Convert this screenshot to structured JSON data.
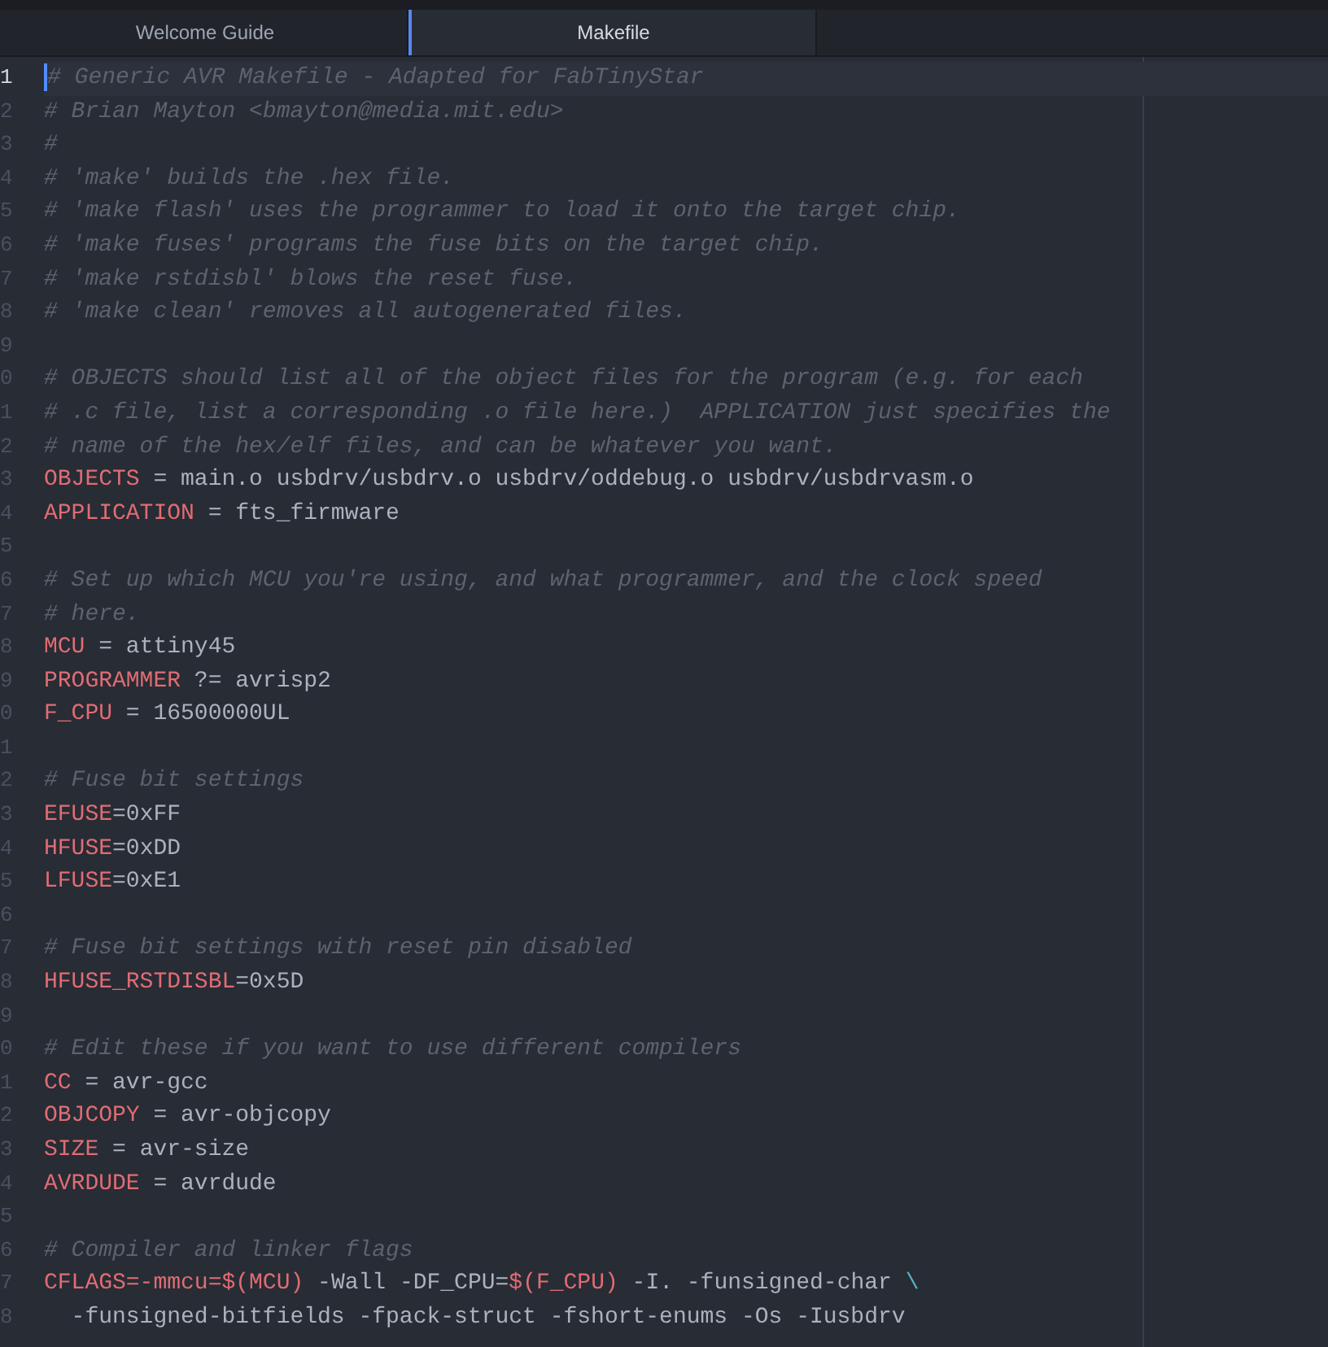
{
  "tabs": [
    {
      "label": "Welcome Guide",
      "selected": false
    },
    {
      "label": "Makefile",
      "selected": true
    }
  ],
  "editor": {
    "lines": [
      {
        "number": "1",
        "current": true,
        "segments": [
          {
            "kind": "comment",
            "text": "# Generic AVR Makefile - Adapted for FabTinyStar"
          }
        ]
      },
      {
        "number": "2",
        "current": false,
        "segments": [
          {
            "kind": "comment",
            "text": "# Brian Mayton <bmayton@media.mit.edu>"
          }
        ]
      },
      {
        "number": "3",
        "current": false,
        "segments": [
          {
            "kind": "comment",
            "text": "#"
          }
        ]
      },
      {
        "number": "4",
        "current": false,
        "segments": [
          {
            "kind": "comment",
            "text": "# 'make' builds the .hex file."
          }
        ]
      },
      {
        "number": "5",
        "current": false,
        "segments": [
          {
            "kind": "comment",
            "text": "# 'make flash' uses the programmer to load it onto the target chip."
          }
        ]
      },
      {
        "number": "6",
        "current": false,
        "segments": [
          {
            "kind": "comment",
            "text": "# 'make fuses' programs the fuse bits on the target chip."
          }
        ]
      },
      {
        "number": "7",
        "current": false,
        "segments": [
          {
            "kind": "comment",
            "text": "# 'make rstdisbl' blows the reset fuse."
          }
        ]
      },
      {
        "number": "8",
        "current": false,
        "segments": [
          {
            "kind": "comment",
            "text": "# 'make clean' removes all autogenerated files."
          }
        ]
      },
      {
        "number": "9",
        "current": false
      },
      {
        "number": "0",
        "current": false,
        "segments": [
          {
            "kind": "comment",
            "text": "# OBJECTS should list all of the object files for the program (e.g. for each"
          }
        ]
      },
      {
        "number": "1",
        "current": false,
        "segments": [
          {
            "kind": "comment",
            "text": "# .c file, list a corresponding .o file here.)  APPLICATION just specifies the"
          }
        ]
      },
      {
        "number": "2",
        "current": false,
        "segments": [
          {
            "kind": "comment",
            "text": "# name of the hex/elf files, and can be whatever you want."
          }
        ]
      },
      {
        "number": "3",
        "current": false,
        "segments": [
          {
            "kind": "variable",
            "text": "OBJECTS"
          },
          {
            "kind": "plain",
            "text": " = main.o usbdrv/usbdrv.o usbdrv/oddebug.o usbdrv/usbdrvasm.o"
          }
        ]
      },
      {
        "number": "4",
        "current": false,
        "segments": [
          {
            "kind": "variable",
            "text": "APPLICATION"
          },
          {
            "kind": "plain",
            "text": " = fts_firmware"
          }
        ]
      },
      {
        "number": "5",
        "current": false
      },
      {
        "number": "6",
        "current": false,
        "segments": [
          {
            "kind": "comment",
            "text": "# Set up which MCU you're using, and what programmer, and the clock speed"
          }
        ]
      },
      {
        "number": "7",
        "current": false,
        "segments": [
          {
            "kind": "comment",
            "text": "# here."
          }
        ]
      },
      {
        "number": "8",
        "current": false,
        "segments": [
          {
            "kind": "variable",
            "text": "MCU"
          },
          {
            "kind": "plain",
            "text": " = attiny45"
          }
        ]
      },
      {
        "number": "9",
        "current": false,
        "segments": [
          {
            "kind": "variable",
            "text": "PROGRAMMER"
          },
          {
            "kind": "plain",
            "text": " ?= avrisp2"
          }
        ]
      },
      {
        "number": "0",
        "current": false,
        "segments": [
          {
            "kind": "variable",
            "text": "F_CPU"
          },
          {
            "kind": "plain",
            "text": " = 16500000UL"
          }
        ]
      },
      {
        "number": "1",
        "current": false
      },
      {
        "number": "2",
        "current": false,
        "segments": [
          {
            "kind": "comment",
            "text": "# Fuse bit settings"
          }
        ]
      },
      {
        "number": "3",
        "current": false,
        "segments": [
          {
            "kind": "variable",
            "text": "EFUSE"
          },
          {
            "kind": "plain",
            "text": "=0xFF"
          }
        ]
      },
      {
        "number": "4",
        "current": false,
        "segments": [
          {
            "kind": "variable",
            "text": "HFUSE"
          },
          {
            "kind": "plain",
            "text": "=0xDD"
          }
        ]
      },
      {
        "number": "5",
        "current": false,
        "segments": [
          {
            "kind": "variable",
            "text": "LFUSE"
          },
          {
            "kind": "plain",
            "text": "=0xE1"
          }
        ]
      },
      {
        "number": "6",
        "current": false
      },
      {
        "number": "7",
        "current": false,
        "segments": [
          {
            "kind": "comment",
            "text": "# Fuse bit settings with reset pin disabled"
          }
        ]
      },
      {
        "number": "8",
        "current": false,
        "segments": [
          {
            "kind": "variable",
            "text": "HFUSE_RSTDISBL"
          },
          {
            "kind": "plain",
            "text": "=0x5D"
          }
        ]
      },
      {
        "number": "9",
        "current": false
      },
      {
        "number": "0",
        "current": false,
        "segments": [
          {
            "kind": "comment",
            "text": "# Edit these if you want to use different compilers"
          }
        ]
      },
      {
        "number": "1",
        "current": false,
        "segments": [
          {
            "kind": "variable",
            "text": "CC"
          },
          {
            "kind": "plain",
            "text": " = avr-gcc"
          }
        ]
      },
      {
        "number": "2",
        "current": false,
        "segments": [
          {
            "kind": "variable",
            "text": "OBJCOPY"
          },
          {
            "kind": "plain",
            "text": " = avr-objcopy"
          }
        ]
      },
      {
        "number": "3",
        "current": false,
        "segments": [
          {
            "kind": "variable",
            "text": "SIZE"
          },
          {
            "kind": "plain",
            "text": " = avr-size"
          }
        ]
      },
      {
        "number": "4",
        "current": false,
        "segments": [
          {
            "kind": "variable",
            "text": "AVRDUDE"
          },
          {
            "kind": "plain",
            "text": " = avrdude"
          }
        ]
      },
      {
        "number": "5",
        "current": false
      },
      {
        "number": "6",
        "current": false,
        "segments": [
          {
            "kind": "comment",
            "text": "# Compiler and linker flags"
          }
        ]
      },
      {
        "number": "7",
        "current": false,
        "segments": [
          {
            "kind": "variable",
            "text": "CFLAGS=-mmcu="
          },
          {
            "kind": "variable",
            "text": "$(MCU)"
          },
          {
            "kind": "plain",
            "text": " -Wall -DF_CPU="
          },
          {
            "kind": "variable",
            "text": "$(F_CPU)"
          },
          {
            "kind": "plain",
            "text": " -I. -funsigned-char "
          },
          {
            "kind": "escape",
            "text": "\\"
          }
        ]
      },
      {
        "number": "8",
        "current": false,
        "segments": [
          {
            "kind": "plain",
            "text": "  -funsigned-bitfields -fpack-struct -fshort-enums -Os -Iusbdrv"
          }
        ]
      }
    ]
  }
}
